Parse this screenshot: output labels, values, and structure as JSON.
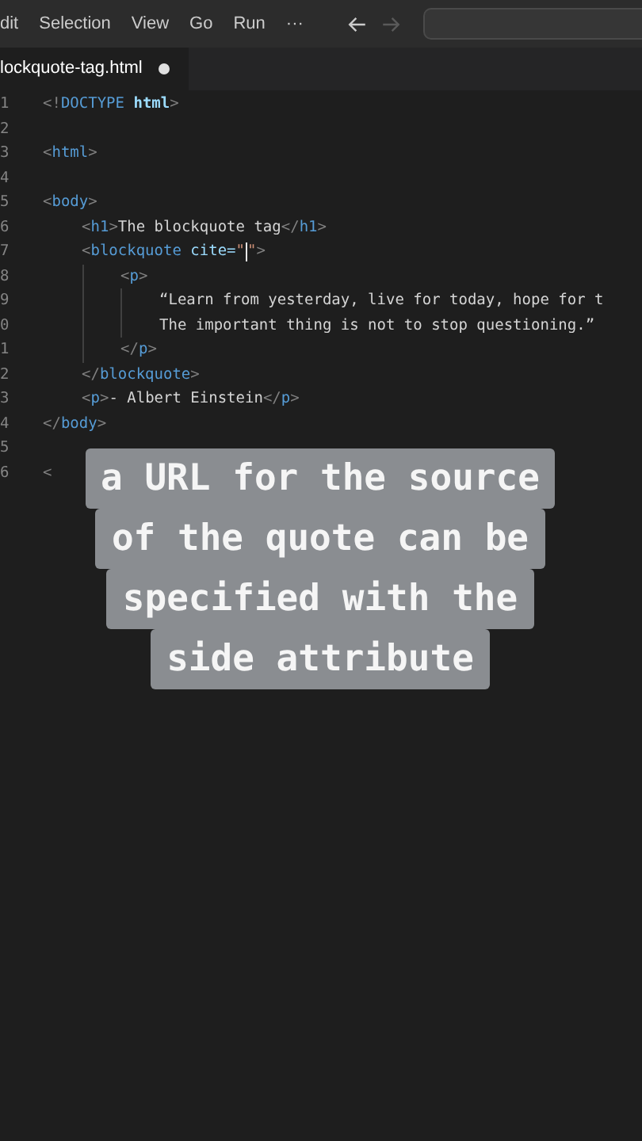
{
  "menu_bar": {
    "items": [
      "dit",
      "Selection",
      "View",
      "Go",
      "Run",
      "···"
    ],
    "back_enabled": true,
    "forward_enabled": false
  },
  "tabs": [
    {
      "label": "lockquote-tag.html",
      "selected": true,
      "modified": true
    }
  ],
  "editor": {
    "lines": [
      {
        "number": "1",
        "kind": "root",
        "tokens": [
          {
            "kind": "punct",
            "text": "<!"
          },
          {
            "kind": "tag",
            "text": "DOCTYPE"
          },
          {
            "kind": "keyword",
            "text": " html"
          },
          {
            "kind": "punct",
            "text": ">"
          }
        ]
      },
      {
        "number": "2",
        "kind": "root"
      },
      {
        "number": "3",
        "kind": "root",
        "tokens": [
          {
            "kind": "punct",
            "text": "<"
          },
          {
            "kind": "tag",
            "text": "html"
          },
          {
            "kind": "punct",
            "text": ">"
          }
        ]
      },
      {
        "number": "4",
        "kind": "root"
      },
      {
        "number": "5",
        "kind": "root",
        "tokens": [
          {
            "kind": "punct",
            "text": "<"
          },
          {
            "kind": "tag",
            "text": "body"
          },
          {
            "kind": "punct",
            "text": ">"
          }
        ]
      },
      {
        "number": "6",
        "kind": "child",
        "tokens": [
          {
            "kind": "punct",
            "text": "<"
          },
          {
            "kind": "tag",
            "text": "h1"
          },
          {
            "kind": "punct",
            "text": ">"
          },
          {
            "kind": "text",
            "text": "The blockquote tag"
          },
          {
            "kind": "punct",
            "text": "</"
          },
          {
            "kind": "tag",
            "text": "h1"
          },
          {
            "kind": "punct",
            "text": ">"
          }
        ]
      },
      {
        "number": "7",
        "kind": "child",
        "tokens": [
          {
            "kind": "punct",
            "text": "<"
          },
          {
            "kind": "tag",
            "text": "blockquote"
          },
          {
            "kind": "attr",
            "text": " cite="
          },
          {
            "kind": "string",
            "text": "\""
          },
          {
            "kind": "cursor"
          },
          {
            "kind": "string",
            "text": "\""
          },
          {
            "kind": "punct",
            "text": ">"
          }
        ]
      },
      {
        "number": "8",
        "kind": "grandchild",
        "tokens": [
          {
            "kind": "punct",
            "text": "<"
          },
          {
            "kind": "tag",
            "text": "p"
          },
          {
            "kind": "punct",
            "text": ">"
          }
        ]
      },
      {
        "number": "9",
        "kind": "content",
        "tokens": [
          {
            "kind": "text",
            "text": "“Learn from yesterday, live for today, hope for t"
          }
        ]
      },
      {
        "number": "0",
        "kind": "content",
        "tokens": [
          {
            "kind": "text",
            "text": "The important thing is not to stop questioning.”"
          }
        ]
      },
      {
        "number": "1",
        "kind": "grandchild",
        "tokens": [
          {
            "kind": "punct",
            "text": "</"
          },
          {
            "kind": "tag",
            "text": "p"
          },
          {
            "kind": "punct",
            "text": ">"
          }
        ]
      },
      {
        "number": "2",
        "kind": "child",
        "tokens": [
          {
            "kind": "punct",
            "text": "</"
          },
          {
            "kind": "tag",
            "text": "blockquote"
          },
          {
            "kind": "punct",
            "text": ">"
          }
        ]
      },
      {
        "number": "3",
        "kind": "child",
        "tokens": [
          {
            "kind": "punct",
            "text": "<"
          },
          {
            "kind": "tag",
            "text": "p"
          },
          {
            "kind": "punct",
            "text": ">"
          },
          {
            "kind": "text",
            "text": "- Albert Einstein"
          },
          {
            "kind": "punct",
            "text": "</"
          },
          {
            "kind": "tag",
            "text": "p"
          },
          {
            "kind": "punct",
            "text": ">"
          }
        ]
      },
      {
        "number": "4",
        "kind": "root",
        "tokens": [
          {
            "kind": "punct",
            "text": "</"
          },
          {
            "kind": "tag",
            "text": "body"
          },
          {
            "kind": "punct",
            "text": ">"
          }
        ]
      },
      {
        "number": "5",
        "kind": "root"
      },
      {
        "number": "6",
        "kind": "root",
        "tokens": [
          {
            "kind": "punct",
            "text": "<"
          }
        ]
      }
    ]
  },
  "caption": {
    "lines": [
      "a URL for the source",
      "of the quote can be",
      "specified with the",
      "side attribute"
    ]
  }
}
